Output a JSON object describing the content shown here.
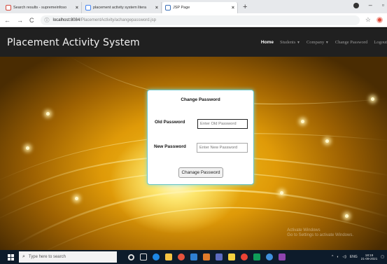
{
  "browser": {
    "tabs": [
      {
        "title": "Search results - supremeinfoso",
        "color": "#d44638",
        "icon": "gmail-icon"
      },
      {
        "title": "placement activity system litera",
        "color": "#4285f4",
        "icon": "google-icon"
      },
      {
        "title": "JSP Page",
        "color": "#3b6fb6",
        "icon": "page-icon"
      }
    ],
    "url_host": "localhost:8084",
    "url_path": "/PlacementActivity/achangepassword.jsp"
  },
  "app": {
    "brand": "Placement Activity System",
    "nav": {
      "home": "Home",
      "students": "Students",
      "company": "Company",
      "change_password": "Change Password",
      "logout": "Logout"
    }
  },
  "form": {
    "title": "Change Password",
    "old_label": "Old Password",
    "old_placeholder": "Enter Old Password",
    "new_label": "New Password",
    "new_placeholder": "Enter New Password",
    "submit": "Chanage Password"
  },
  "watermark": {
    "line1": "Activate Windows",
    "line2": "Go to Settings to activate Windows."
  },
  "taskbar": {
    "search_placeholder": "Type here to search",
    "lang": "ENG",
    "time": "18:19",
    "date": "21-09-2021"
  },
  "colors": {
    "navbar": "#202020",
    "card_border": "#6cc4c8",
    "taskbar": "#0d1b2a"
  }
}
